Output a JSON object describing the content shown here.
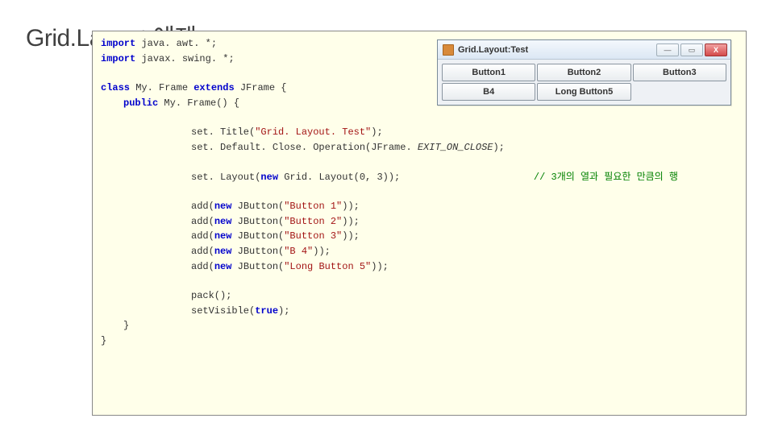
{
  "heading": "Grid.Layout  예제",
  "code": {
    "import1_kw": "import",
    "import1_rest": " java. awt. *;",
    "import2_kw": "import",
    "import2_rest": " javax. swing. *;",
    "class_kw": "class",
    "class_name": " My. Frame ",
    "extends_kw": "extends",
    "class_rest": " JFrame {",
    "public_kw": "public",
    "ctor_rest": " My. Frame() {",
    "setTitle_pre": "set. Title(",
    "setTitle_str": "\"Grid. Layout. Test\"",
    "setTitle_post": ");",
    "setDefault_pre": "set. Default. Close. Operation(JFrame. ",
    "setDefault_const": "EXIT_ON_CLOSE",
    "setDefault_post": ");",
    "setLayout_pre": "set. Layout(",
    "new_kw": "new",
    "setLayout_post": " Grid. Layout(0, 3));",
    "comment": "// 3개의 열과 필요한 만큼의 행",
    "add1_pre": "add(",
    "add1_mid": " JButton(",
    "add1_str": "\"Button 1\"",
    "add1_post": "));",
    "add2_str": "\"Button 2\"",
    "add3_str": "\"Button 3\"",
    "add4_str": "\"B 4\"",
    "add5_str": "\"Long Button 5\"",
    "pack": "pack();",
    "setVisible_pre": "setVisible(",
    "true_kw": "true",
    "setVisible_post": ");",
    "brace": "}"
  },
  "window": {
    "title": "Grid.Layout:Test",
    "min": "—",
    "max": "▭",
    "close": "X",
    "buttons": [
      "Button1",
      "Button2",
      "Button3",
      "B4",
      "Long Button5",
      ""
    ]
  }
}
